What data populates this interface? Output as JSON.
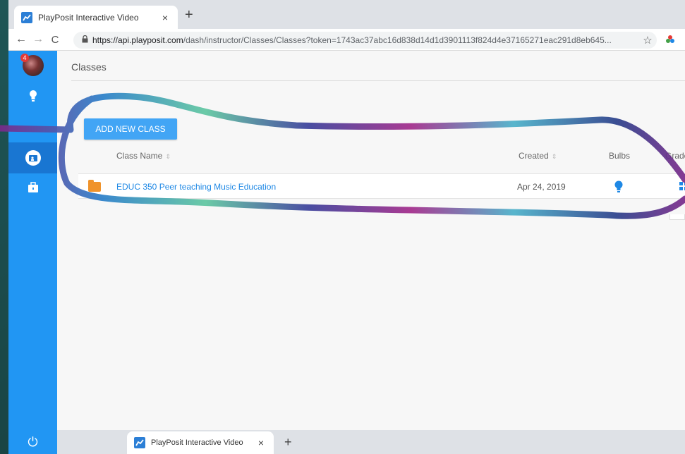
{
  "browser": {
    "tab_title": "PlayPosit Interactive Video",
    "tab_close": "×",
    "new_tab": "+",
    "url_host": "https://api.playposit.com",
    "url_path": "/dash/instructor/Classes/Classes?token=1743ac37abc16d838d14d1d3901113f824d4e37165271eac291d8eb645...",
    "back": "←",
    "forward": "→",
    "reload": "C",
    "bookmark": "☆"
  },
  "sidebar": {
    "avatar_badge": "4",
    "power": "⏻"
  },
  "page": {
    "title": "Classes",
    "add_button": "ADD NEW CLASS"
  },
  "table": {
    "headers": {
      "class_name": "Class Name",
      "created": "Created",
      "bulbs": "Bulbs",
      "grades": "Grade"
    },
    "sort_glyph": "⇕",
    "rows": [
      {
        "class_name": "EDUC 350 Peer teaching Music Education",
        "created": "Apr 24, 2019"
      }
    ]
  },
  "bottom_tab": {
    "title": "PlayPosit Interactive Video",
    "close": "×",
    "new_tab": "+"
  },
  "colors": {
    "sidebar": "#2196f3",
    "sidebar_active": "#1976d2",
    "accent_button": "#42a5f5",
    "link": "#1e88e5",
    "folder": "#f0932b"
  }
}
